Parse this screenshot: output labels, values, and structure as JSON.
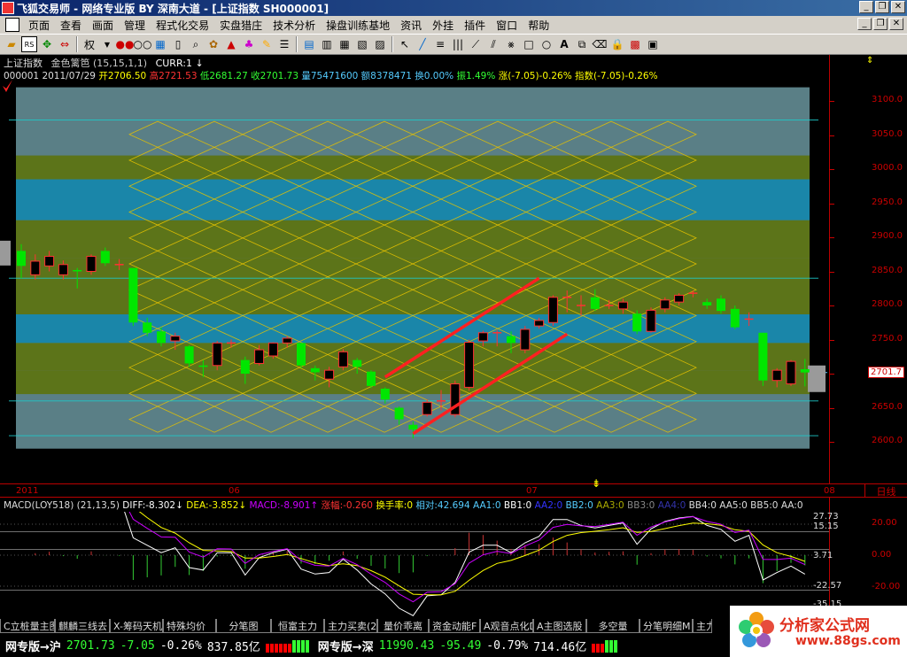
{
  "window": {
    "title": "飞狐交易师 - 网络专业版 BY 深南大道 - [上证指数 SH000001]"
  },
  "menu": {
    "items": [
      "页面",
      "查看",
      "画面",
      "管理",
      "程式化交易",
      "实盘猎庄",
      "技术分析",
      "操盘训练基地",
      "资讯",
      "外挂",
      "插件",
      "窗口",
      "帮助"
    ]
  },
  "toolbar": {
    "right_label": "权"
  },
  "main_chart": {
    "name": "上证指数",
    "indicator": "金色篱笆",
    "params": "(15,15,1,1)",
    "curr": "CURR:1",
    "curr_arrow": "↓",
    "code": "000001",
    "date": "2011/07/29",
    "open_label": "开",
    "open": "2706.50",
    "high_label": "高",
    "high": "2721.53",
    "low_label": "低",
    "low": "2681.27",
    "close_label": "收",
    "close": "2701.73",
    "volume_label": "量",
    "volume": "75471600",
    "amount_label": "额",
    "amount": "8378471",
    "turnover_label": "换",
    "turnover": "0.00%",
    "amplitude_label": "振",
    "amplitude": "1.49%",
    "change_label": "涨",
    "change": "(-7.05)-0.26%",
    "index_label": "指数",
    "index_change": "(-7.05)-0.26%",
    "price_ticks": [
      "3100.0",
      "3050.0",
      "3000.0",
      "2950.0",
      "2900.0",
      "2850.0",
      "2800.0",
      "2750.0",
      "2700.0",
      "2650.0",
      "2600.0"
    ],
    "current_price_tag": "2701.7",
    "date_labels": [
      "2011",
      "06",
      "07",
      "08"
    ],
    "period_button": "日线",
    "colors": {
      "up": "#ff3232",
      "down": "#00e600",
      "band_grey": "#5a7f86",
      "band_olive": "#5c7419",
      "band_blue": "#1a86a9",
      "lattice": "#e6c200",
      "channel": "#ff2020"
    }
  },
  "chart_data": {
    "type": "candlestick",
    "period": "daily",
    "ylim": [
      2590,
      3120
    ],
    "y_ticks": [
      2600,
      2650,
      2700,
      2750,
      2800,
      2850,
      2900,
      2950,
      3000,
      3050,
      3100
    ],
    "x_labels": [
      "2011",
      "06",
      "07",
      "08"
    ],
    "candles": [
      {
        "o": 2880,
        "c": 2858,
        "h": 2890,
        "l": 2840
      },
      {
        "o": 2845,
        "c": 2865,
        "h": 2875,
        "l": 2838
      },
      {
        "o": 2858,
        "c": 2872,
        "h": 2880,
        "l": 2850
      },
      {
        "o": 2845,
        "c": 2860,
        "h": 2866,
        "l": 2838
      },
      {
        "o": 2852,
        "c": 2850,
        "h": 2855,
        "l": 2825
      },
      {
        "o": 2850,
        "c": 2872,
        "h": 2875,
        "l": 2845
      },
      {
        "o": 2880,
        "c": 2862,
        "h": 2885,
        "l": 2858
      },
      {
        "o": 2860,
        "c": 2860,
        "h": 2868,
        "l": 2852
      },
      {
        "o": 2855,
        "c": 2775,
        "h": 2855,
        "l": 2770
      },
      {
        "o": 2775,
        "c": 2760,
        "h": 2782,
        "l": 2755
      },
      {
        "o": 2762,
        "c": 2745,
        "h": 2768,
        "l": 2740
      },
      {
        "o": 2748,
        "c": 2755,
        "h": 2760,
        "l": 2735
      },
      {
        "o": 2740,
        "c": 2715,
        "h": 2742,
        "l": 2710
      },
      {
        "o": 2712,
        "c": 2710,
        "h": 2720,
        "l": 2695
      },
      {
        "o": 2712,
        "c": 2745,
        "h": 2748,
        "l": 2705
      },
      {
        "o": 2745,
        "c": 2745,
        "h": 2750,
        "l": 2738
      },
      {
        "o": 2720,
        "c": 2700,
        "h": 2725,
        "l": 2685
      },
      {
        "o": 2715,
        "c": 2735,
        "h": 2742,
        "l": 2712
      },
      {
        "o": 2726,
        "c": 2745,
        "h": 2746,
        "l": 2722
      },
      {
        "o": 2745,
        "c": 2752,
        "h": 2755,
        "l": 2738
      },
      {
        "o": 2745,
        "c": 2712,
        "h": 2745,
        "l": 2708
      },
      {
        "o": 2708,
        "c": 2702,
        "h": 2712,
        "l": 2690
      },
      {
        "o": 2692,
        "c": 2705,
        "h": 2710,
        "l": 2680
      },
      {
        "o": 2710,
        "c": 2732,
        "h": 2736,
        "l": 2705
      },
      {
        "o": 2720,
        "c": 2710,
        "h": 2723,
        "l": 2700
      },
      {
        "o": 2703,
        "c": 2682,
        "h": 2705,
        "l": 2679
      },
      {
        "o": 2678,
        "c": 2662,
        "h": 2680,
        "l": 2656
      },
      {
        "o": 2650,
        "c": 2633,
        "h": 2652,
        "l": 2625
      },
      {
        "o": 2625,
        "c": 2618,
        "h": 2630,
        "l": 2605
      },
      {
        "o": 2640,
        "c": 2658,
        "h": 2662,
        "l": 2637
      },
      {
        "o": 2660,
        "c": 2660,
        "h": 2676,
        "l": 2646
      },
      {
        "o": 2640,
        "c": 2685,
        "h": 2690,
        "l": 2636
      },
      {
        "o": 2680,
        "c": 2746,
        "h": 2750,
        "l": 2675
      },
      {
        "o": 2748,
        "c": 2760,
        "h": 2763,
        "l": 2740
      },
      {
        "o": 2760,
        "c": 2760,
        "h": 2764,
        "l": 2740
      },
      {
        "o": 2755,
        "c": 2745,
        "h": 2762,
        "l": 2730
      },
      {
        "o": 2735,
        "c": 2765,
        "h": 2770,
        "l": 2730
      },
      {
        "o": 2770,
        "c": 2778,
        "h": 2782,
        "l": 2766
      },
      {
        "o": 2775,
        "c": 2812,
        "h": 2815,
        "l": 2770
      },
      {
        "o": 2812,
        "c": 2812,
        "h": 2822,
        "l": 2790
      },
      {
        "o": 2800,
        "c": 2800,
        "h": 2815,
        "l": 2785
      },
      {
        "o": 2812,
        "c": 2795,
        "h": 2824,
        "l": 2792
      },
      {
        "o": 2800,
        "c": 2800,
        "h": 2808,
        "l": 2795
      },
      {
        "o": 2795,
        "c": 2805,
        "h": 2810,
        "l": 2788
      },
      {
        "o": 2788,
        "c": 2762,
        "h": 2793,
        "l": 2758
      },
      {
        "o": 2762,
        "c": 2793,
        "h": 2797,
        "l": 2760
      },
      {
        "o": 2795,
        "c": 2808,
        "h": 2812,
        "l": 2790
      },
      {
        "o": 2805,
        "c": 2815,
        "h": 2818,
        "l": 2800
      },
      {
        "o": 2818,
        "c": 2818,
        "h": 2822,
        "l": 2812
      },
      {
        "o": 2805,
        "c": 2800,
        "h": 2810,
        "l": 2795
      },
      {
        "o": 2810,
        "c": 2792,
        "h": 2815,
        "l": 2788
      },
      {
        "o": 2795,
        "c": 2768,
        "h": 2800,
        "l": 2765
      },
      {
        "o": 2780,
        "c": 2780,
        "h": 2790,
        "l": 2770
      },
      {
        "o": 2760,
        "c": 2690,
        "h": 2760,
        "l": 2682
      },
      {
        "o": 2690,
        "c": 2705,
        "h": 2708,
        "l": 2680
      },
      {
        "o": 2685,
        "c": 2718,
        "h": 2720,
        "l": 2682
      },
      {
        "o": 2706.5,
        "c": 2701.73,
        "h": 2721.53,
        "l": 2681.27
      }
    ],
    "channel_lines": [
      {
        "x1": 26,
        "y1": 2695,
        "x2": 37,
        "y2": 2840
      },
      {
        "x1": 28,
        "y1": 2612,
        "x2": 39,
        "y2": 2758
      }
    ]
  },
  "macd": {
    "name": "MACD",
    "source": "LOY518",
    "params": "(21,13,5)",
    "diff": "DIFF:-8.302",
    "dea": "DEA:-3.852",
    "macd_val": "MACD:-8.901",
    "rise": "涨幅:-0.260",
    "turnover_rate": "换手率:0",
    "relative": "相对:42.694",
    "aa1": "AA1:0",
    "bb1": "BB1:0",
    "aa2": "AA2:0",
    "bb2": "BB2:0",
    "aa3": "AA3:0",
    "bb3": "BB3:0",
    "aa4": "AA4:0",
    "bb4": "BB4:0",
    "aa5": "AA5:0",
    "bb5": "BB5:0",
    "aa_tail": "AA:0",
    "ticks": [
      "20.00",
      "0.00",
      "-20.00"
    ],
    "side_values": [
      "27.73",
      "15.15",
      "3.71",
      "-22.57",
      "-35.15"
    ]
  },
  "tabs": [
    "C立桩量主图",
    "麒麟三线去",
    "X-筹码天机",
    "特殊均价",
    "分笔图",
    "恒富主力",
    "主力买卖(2",
    "量价乖离",
    "资金动能F",
    "A观音点化D",
    "A主图选股",
    "多空量",
    "分笔明细M",
    "主力动"
  ],
  "status": {
    "sh_title": "网专版→沪",
    "sh_index": "2701.73",
    "sh_change": "-7.05",
    "sh_pct": "-0.26%",
    "sh_amount": "837.85亿",
    "sz_title": "网专版→深",
    "sz_index": "11990.43",
    "sz_change": "-95.49",
    "sz_pct": "-0.79%",
    "sz_amount": "714.46亿"
  },
  "logo": {
    "text": "分析家公式网",
    "url": "www.88gs.com"
  }
}
